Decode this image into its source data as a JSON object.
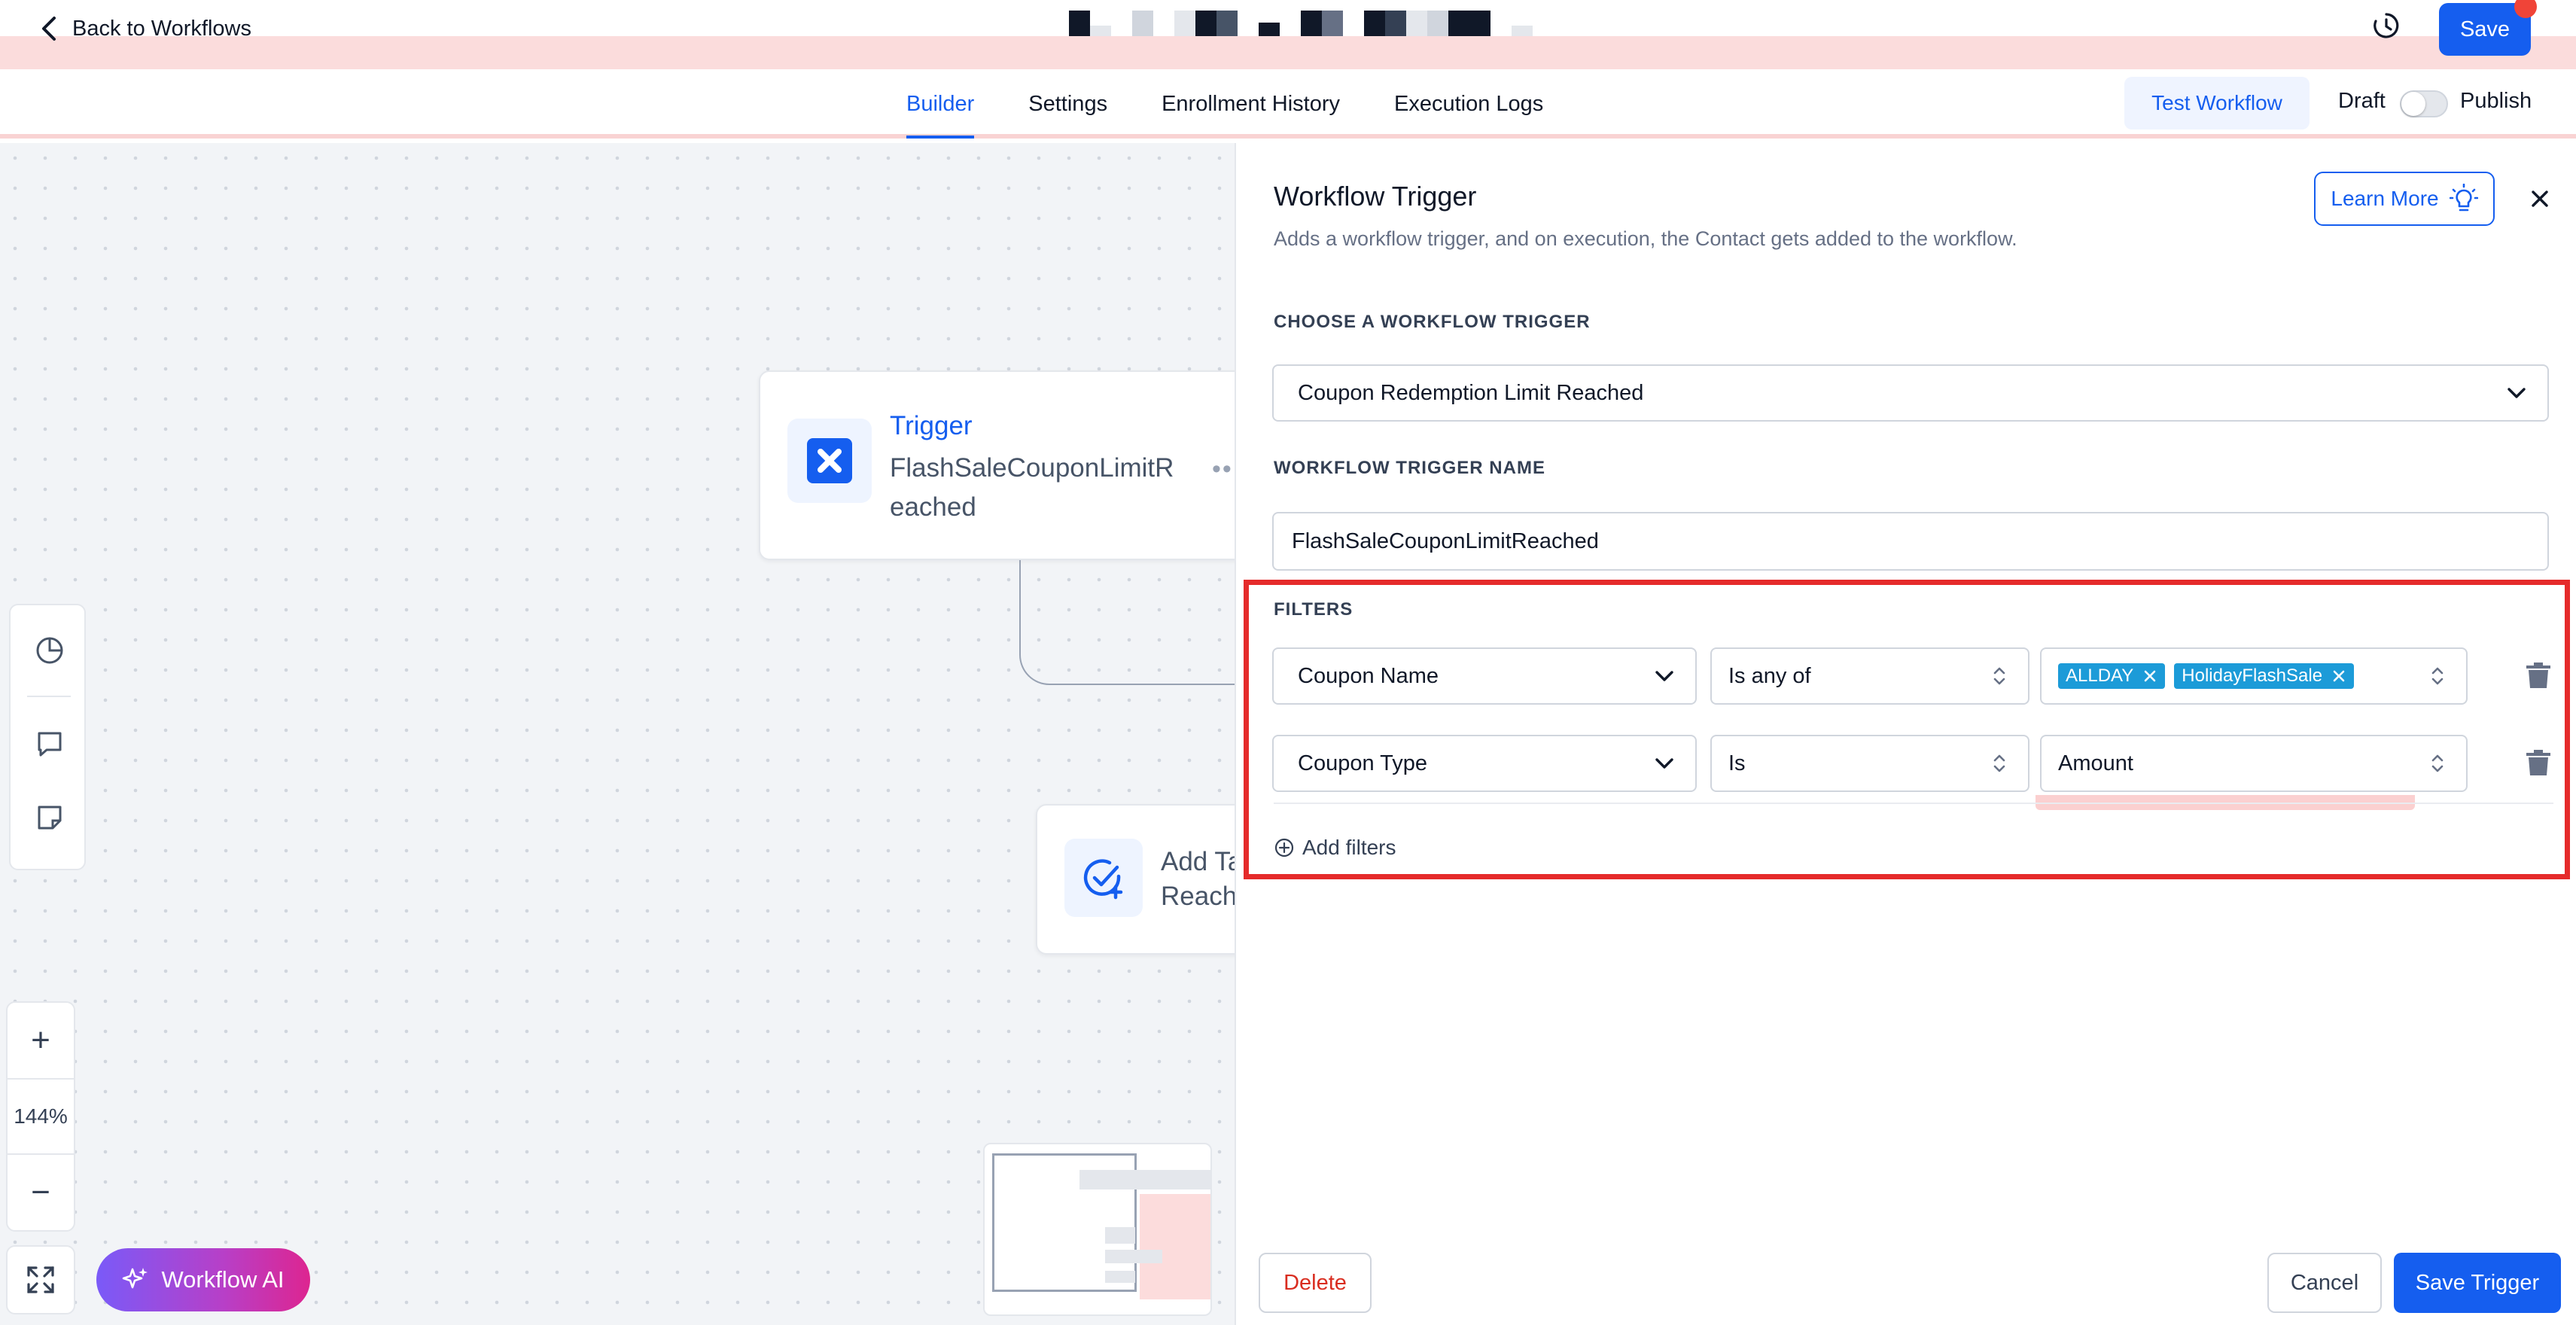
{
  "header": {
    "back_label": "Back to Workflows",
    "save_label": "Save",
    "icons": {
      "back": "chevron-left-icon",
      "history": "history-clock-icon"
    }
  },
  "tabs": [
    {
      "label": "Builder",
      "active": true
    },
    {
      "label": "Settings",
      "active": false
    },
    {
      "label": "Enrollment History",
      "active": false
    },
    {
      "label": "Execution Logs",
      "active": false
    }
  ],
  "toolbar": {
    "test_label": "Test Workflow",
    "draft_label": "Draft",
    "publish_label": "Publish",
    "published": false
  },
  "canvas": {
    "trigger_node": {
      "title": "Trigger",
      "subtitle": "FlashSaleCouponLimitReached",
      "menu": "••"
    },
    "action_node": {
      "line1": "Add Ta",
      "line2": "Reach"
    },
    "zoom": {
      "level": "144%",
      "in": "+",
      "out": "−"
    },
    "ai_label": "Workflow AI"
  },
  "panel": {
    "title": "Workflow Trigger",
    "description": "Adds a workflow trigger, and on execution, the Contact gets added to the workflow.",
    "learn_more": "Learn More",
    "trigger_section_label": "CHOOSE A WORKFLOW TRIGGER",
    "trigger_value": "Coupon Redemption Limit Reached",
    "name_section_label": "WORKFLOW TRIGGER NAME",
    "name_value": "FlashSaleCouponLimitReached",
    "filters_label": "FILTERS",
    "filters": [
      {
        "field": "Coupon Name",
        "operator": "Is any of",
        "values": [
          "ALLDAY",
          "HolidayFlashSale"
        ]
      },
      {
        "field": "Coupon Type",
        "operator": "Is",
        "value": "Amount"
      }
    ],
    "add_filters": "Add filters",
    "delete_label": "Delete",
    "cancel_label": "Cancel",
    "save_trigger_label": "Save Trigger"
  },
  "colors": {
    "primary": "#155eef",
    "chip": "#1c9bd8",
    "danger": "#d92d20",
    "highlight_box": "#e52b2b"
  }
}
